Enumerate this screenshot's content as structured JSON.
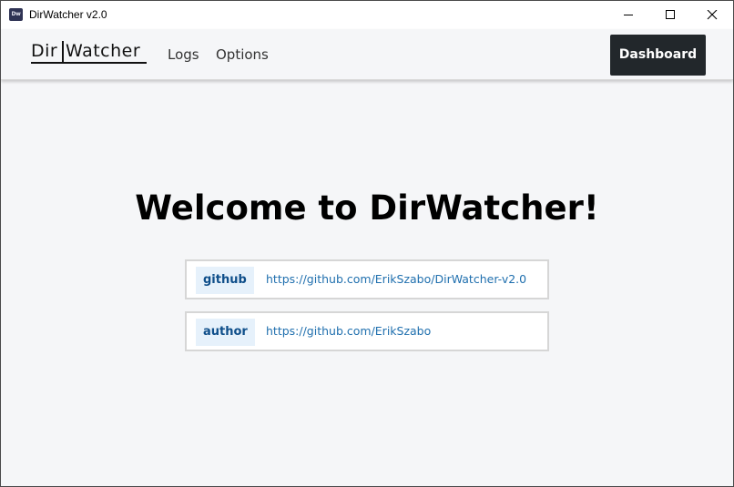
{
  "window": {
    "title": "DirWatcher v2.0",
    "icon_text": "Dw"
  },
  "navbar": {
    "logo_left": "Dir",
    "logo_right": "Watcher",
    "links": [
      "Logs",
      "Options"
    ],
    "dashboard_label": "Dashboard"
  },
  "main": {
    "heading": "Welcome to DirWatcher!",
    "links": [
      {
        "tag": "github",
        "url": "https://github.com/ErikSzabo/DirWatcher-v2.0"
      },
      {
        "tag": "author",
        "url": "https://github.com/ErikSzabo"
      }
    ]
  },
  "colors": {
    "background": "#f5f6f8",
    "dashboard_button": "#22272b",
    "tag_background": "#e6f1fb",
    "tag_text": "#0e4e8a",
    "link": "#1f6fae"
  }
}
